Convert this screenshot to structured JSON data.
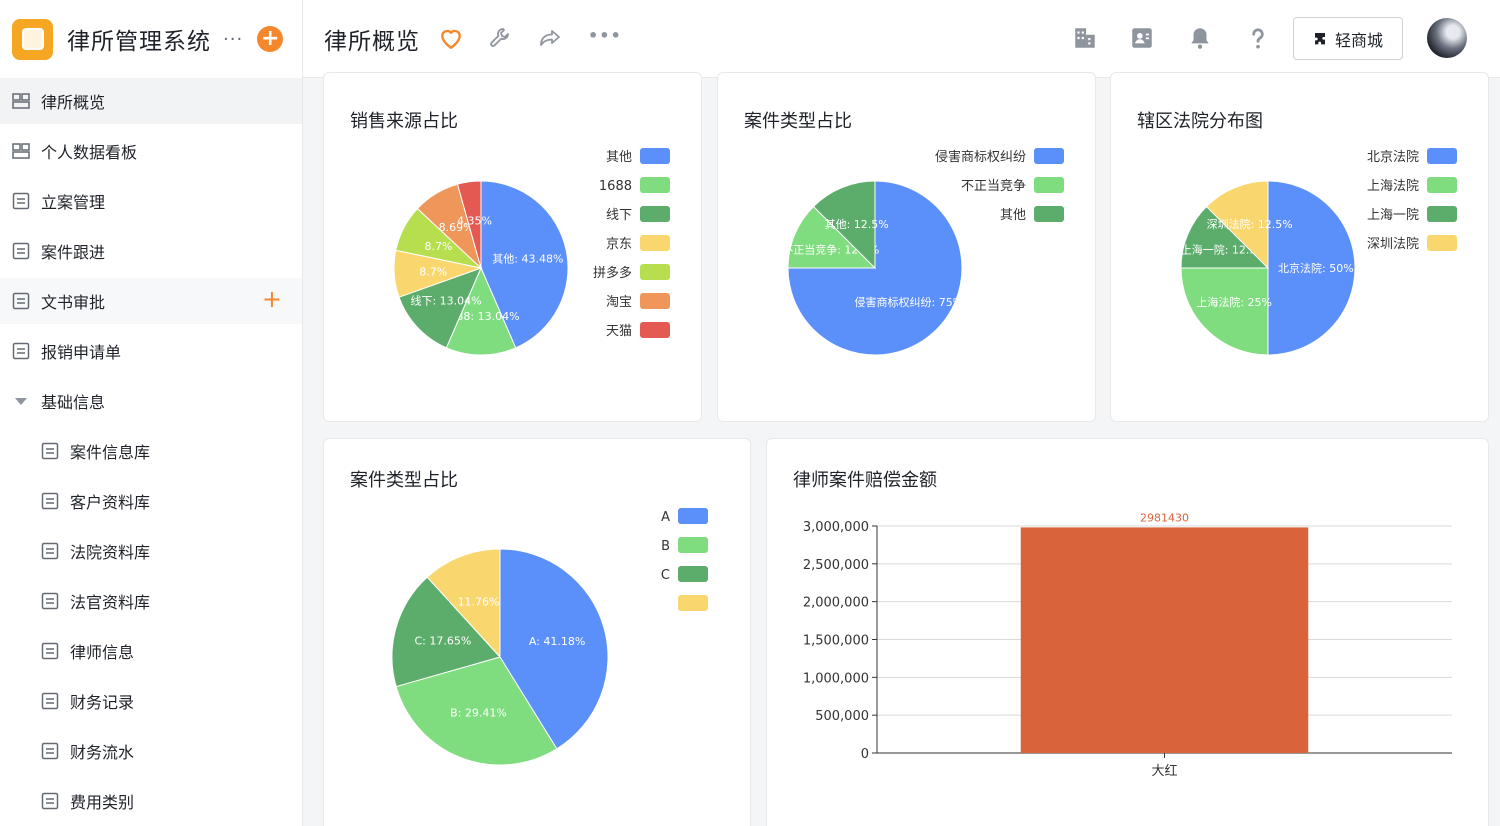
{
  "app": {
    "title": "律所管理系统",
    "more": "···",
    "add": "+"
  },
  "sidebar": {
    "items": [
      {
        "label": "律所概览"
      },
      {
        "label": "个人数据看板"
      },
      {
        "label": "立案管理"
      },
      {
        "label": "案件跟进"
      },
      {
        "label": "文书审批",
        "add": "+"
      },
      {
        "label": "报销申请单"
      },
      {
        "label": "基础信息"
      },
      {
        "label": "案件信息库"
      },
      {
        "label": "客户资料库"
      },
      {
        "label": "法院资料库"
      },
      {
        "label": "法官资料库"
      },
      {
        "label": "律师信息"
      },
      {
        "label": "财务记录"
      },
      {
        "label": "财务流水"
      },
      {
        "label": "费用类别"
      }
    ]
  },
  "header": {
    "title": "律所概览",
    "more": "•••",
    "mall_label": "轻商城"
  },
  "colors": {
    "blue": "#5b8ff9",
    "green": "#7fdc7f",
    "darkgreen": "#5cad6b",
    "yellow": "#fad76e",
    "lime": "#b7de4e",
    "orange": "#ef965a",
    "red": "#e45a53",
    "bar": "#d9633b",
    "accent": "#f5882c"
  },
  "chart_data": [
    {
      "type": "pie",
      "title": "销售来源占比",
      "legend": [
        "其他",
        "1688",
        "线下",
        "京东",
        "拼多多",
        "淘宝",
        "天猫"
      ],
      "slices": [
        {
          "name": "其他",
          "value": 43.48,
          "label": "其他: 43.48%"
        },
        {
          "name": "1688",
          "value": 13.04,
          "label": "1688: 13.04%"
        },
        {
          "name": "线下",
          "value": 13.04,
          "label": "线下: 13.04%"
        },
        {
          "name": "京东",
          "value": 8.7,
          "label": "8.7%"
        },
        {
          "name": "拼多多",
          "value": 8.7,
          "label": "8.7%"
        },
        {
          "name": "淘宝",
          "value": 8.69,
          "label": "8.69%"
        },
        {
          "name": "天猫",
          "value": 4.35,
          "label": "4.35%"
        }
      ]
    },
    {
      "type": "pie",
      "title": "案件类型占比",
      "legend": [
        "侵害商标权纠纷",
        "不正当竞争",
        "其他"
      ],
      "slices": [
        {
          "name": "侵害商标权纠纷",
          "value": 75,
          "label": "侵害商标权纠纷: 75%"
        },
        {
          "name": "不正当竞争",
          "value": 12.5,
          "label": "不正当竞争: 12.5%"
        },
        {
          "name": "其他",
          "value": 12.5,
          "label": "其他: 12.5%"
        }
      ]
    },
    {
      "type": "pie",
      "title": "辖区法院分布图",
      "legend": [
        "北京法院",
        "上海法院",
        "上海一院",
        "深圳法院"
      ],
      "slices": [
        {
          "name": "北京法院",
          "value": 50,
          "label": "北京法院: 50%"
        },
        {
          "name": "上海法院",
          "value": 25,
          "label": "上海法院: 25%"
        },
        {
          "name": "上海一院",
          "value": 12.5,
          "label": "上海一院: 12.5%"
        },
        {
          "name": "深圳法院",
          "value": 12.5,
          "label": "深圳法院: 12.5%"
        }
      ]
    },
    {
      "type": "pie",
      "title": "案件类型占比",
      "legend": [
        "A",
        "B",
        "C",
        ""
      ],
      "slices": [
        {
          "name": "A",
          "value": 41.18,
          "label": "A: 41.18%"
        },
        {
          "name": "B",
          "value": 29.41,
          "label": "B: 29.41%"
        },
        {
          "name": "C",
          "value": 17.65,
          "label": "C: 17.65%"
        },
        {
          "name": "",
          "value": 11.76,
          "label": "11.76%"
        }
      ]
    },
    {
      "type": "bar",
      "title": "律师案件赔偿金额",
      "categories": [
        "大红"
      ],
      "values": [
        2981430
      ],
      "value_labels": [
        "2981430"
      ],
      "ylim": [
        0,
        3000000
      ],
      "yticks": [
        "0",
        "500,000",
        "1,000,000",
        "1,500,000",
        "2,000,000",
        "2,500,000",
        "3,000,000"
      ],
      "grid": true
    }
  ]
}
